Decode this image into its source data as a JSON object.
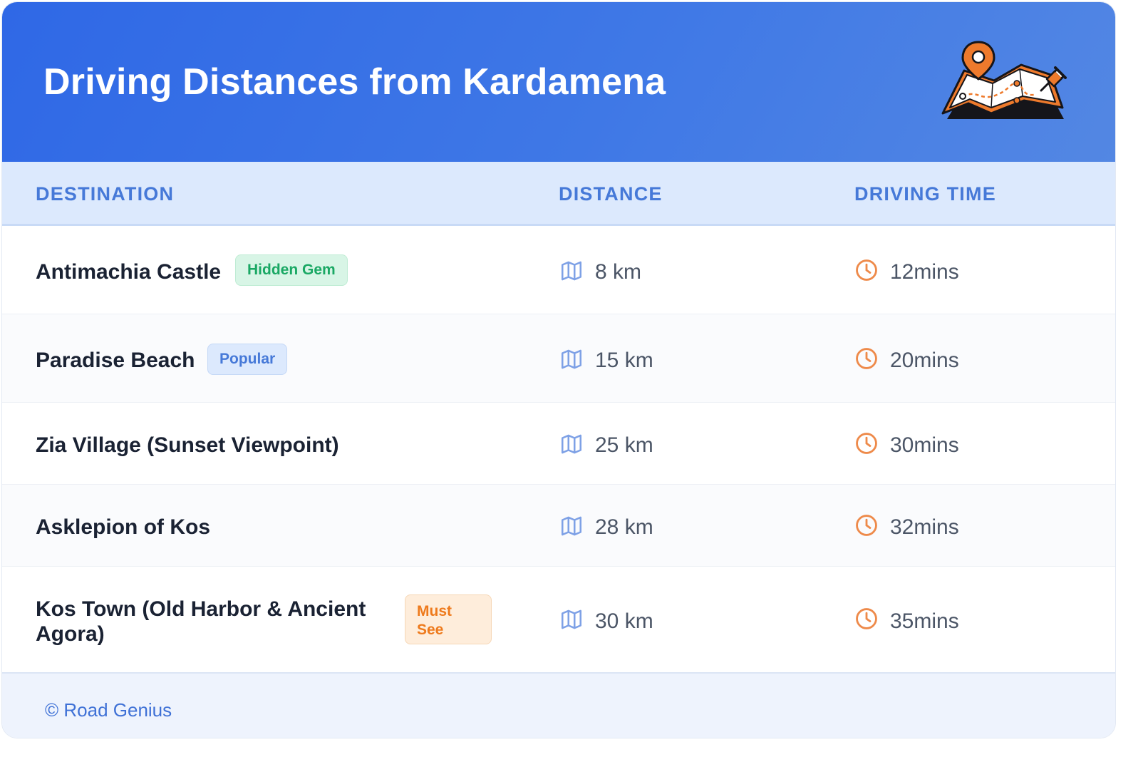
{
  "header": {
    "title": "Driving Distances from Kardamena",
    "illustration_icon": "folded-map-with-location-pin-icon",
    "colors": {
      "gradient_start": "#2f68e6",
      "gradient_end": "#5387e3"
    }
  },
  "table": {
    "columns": [
      "DESTINATION",
      "DISTANCE",
      "DRIVING TIME"
    ],
    "distance_icon": "map-icon",
    "time_icon": "clock-icon",
    "rows": [
      {
        "destination": "Antimachia Castle",
        "badge": "Hidden Gem",
        "badge_color": "#1aa864",
        "distance": "8 km",
        "time": "12mins"
      },
      {
        "destination": "Paradise Beach",
        "badge": "Popular",
        "badge_color": "#4679d8",
        "distance": "15 km",
        "time": "20mins"
      },
      {
        "destination": "Zia Village (Sunset Viewpoint)",
        "badge": "",
        "distance": "25 km",
        "time": "30mins"
      },
      {
        "destination": "Asklepion of Kos",
        "badge": "",
        "distance": "28 km",
        "time": "32mins"
      },
      {
        "destination": "Kos Town (Old Harbor & Ancient Agora)",
        "badge": "Must See",
        "badge_color": "#ee7a1c",
        "distance": "30 km",
        "time": "35mins"
      }
    ]
  },
  "footer": {
    "copyright": "© Road Genius"
  }
}
